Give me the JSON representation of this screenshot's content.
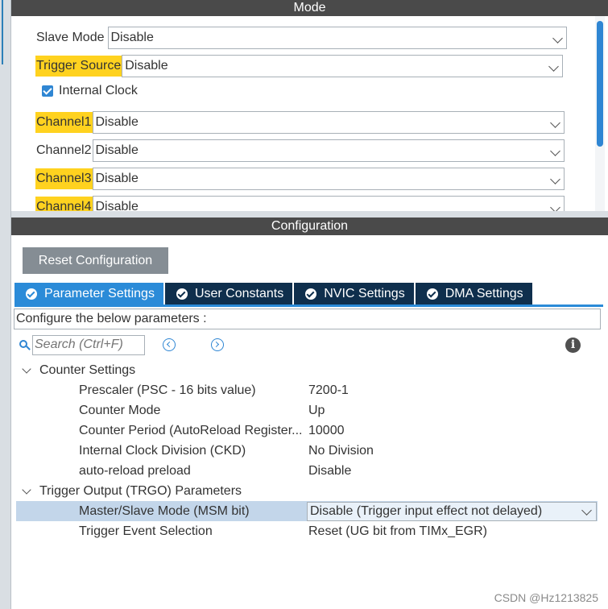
{
  "mode": {
    "header": "Mode",
    "slave_mode": {
      "label": "Slave Mode",
      "value": "Disable"
    },
    "trigger_source": {
      "label": "Trigger Source",
      "value": "Disable"
    },
    "internal_clock": {
      "label": "Internal Clock",
      "checked": true
    },
    "channels": [
      {
        "label": "Channel1",
        "value": "Disable"
      },
      {
        "label": "Channel2",
        "value": "Disable"
      },
      {
        "label": "Channel3",
        "value": "Disable"
      },
      {
        "label": "Channel4",
        "value": "Disable"
      }
    ]
  },
  "configuration": {
    "header": "Configuration",
    "reset_button": "Reset Configuration",
    "tabs": [
      {
        "label": "Parameter Settings",
        "active": true
      },
      {
        "label": "User Constants",
        "active": false
      },
      {
        "label": "NVIC Settings",
        "active": false
      },
      {
        "label": "DMA Settings",
        "active": false
      }
    ],
    "description": "Configure the below parameters :",
    "search_placeholder": "Search (Ctrl+F)",
    "groups": [
      {
        "title": "Counter Settings",
        "params": [
          {
            "name": "Prescaler (PSC - 16 bits value)",
            "value": "7200-1"
          },
          {
            "name": "Counter Mode",
            "value": "Up"
          },
          {
            "name": "Counter Period (AutoReload Register...",
            "value": "10000"
          },
          {
            "name": "Internal Clock Division (CKD)",
            "value": "No Division"
          },
          {
            "name": "auto-reload preload",
            "value": "Disable"
          }
        ]
      },
      {
        "title": "Trigger Output (TRGO) Parameters",
        "params": [
          {
            "name": "Master/Slave Mode (MSM bit)",
            "value": "Disable (Trigger input effect not delayed)"
          },
          {
            "name": "Trigger Event Selection",
            "value": "Reset (UG bit from TIMx_EGR)"
          }
        ]
      }
    ]
  },
  "watermark": "CSDN @Hz1213825",
  "colors": {
    "highlight": "#ffd21f",
    "accent": "#2b8bd8",
    "header": "#4a4a4a",
    "tab_inactive": "#0f2f4d"
  }
}
